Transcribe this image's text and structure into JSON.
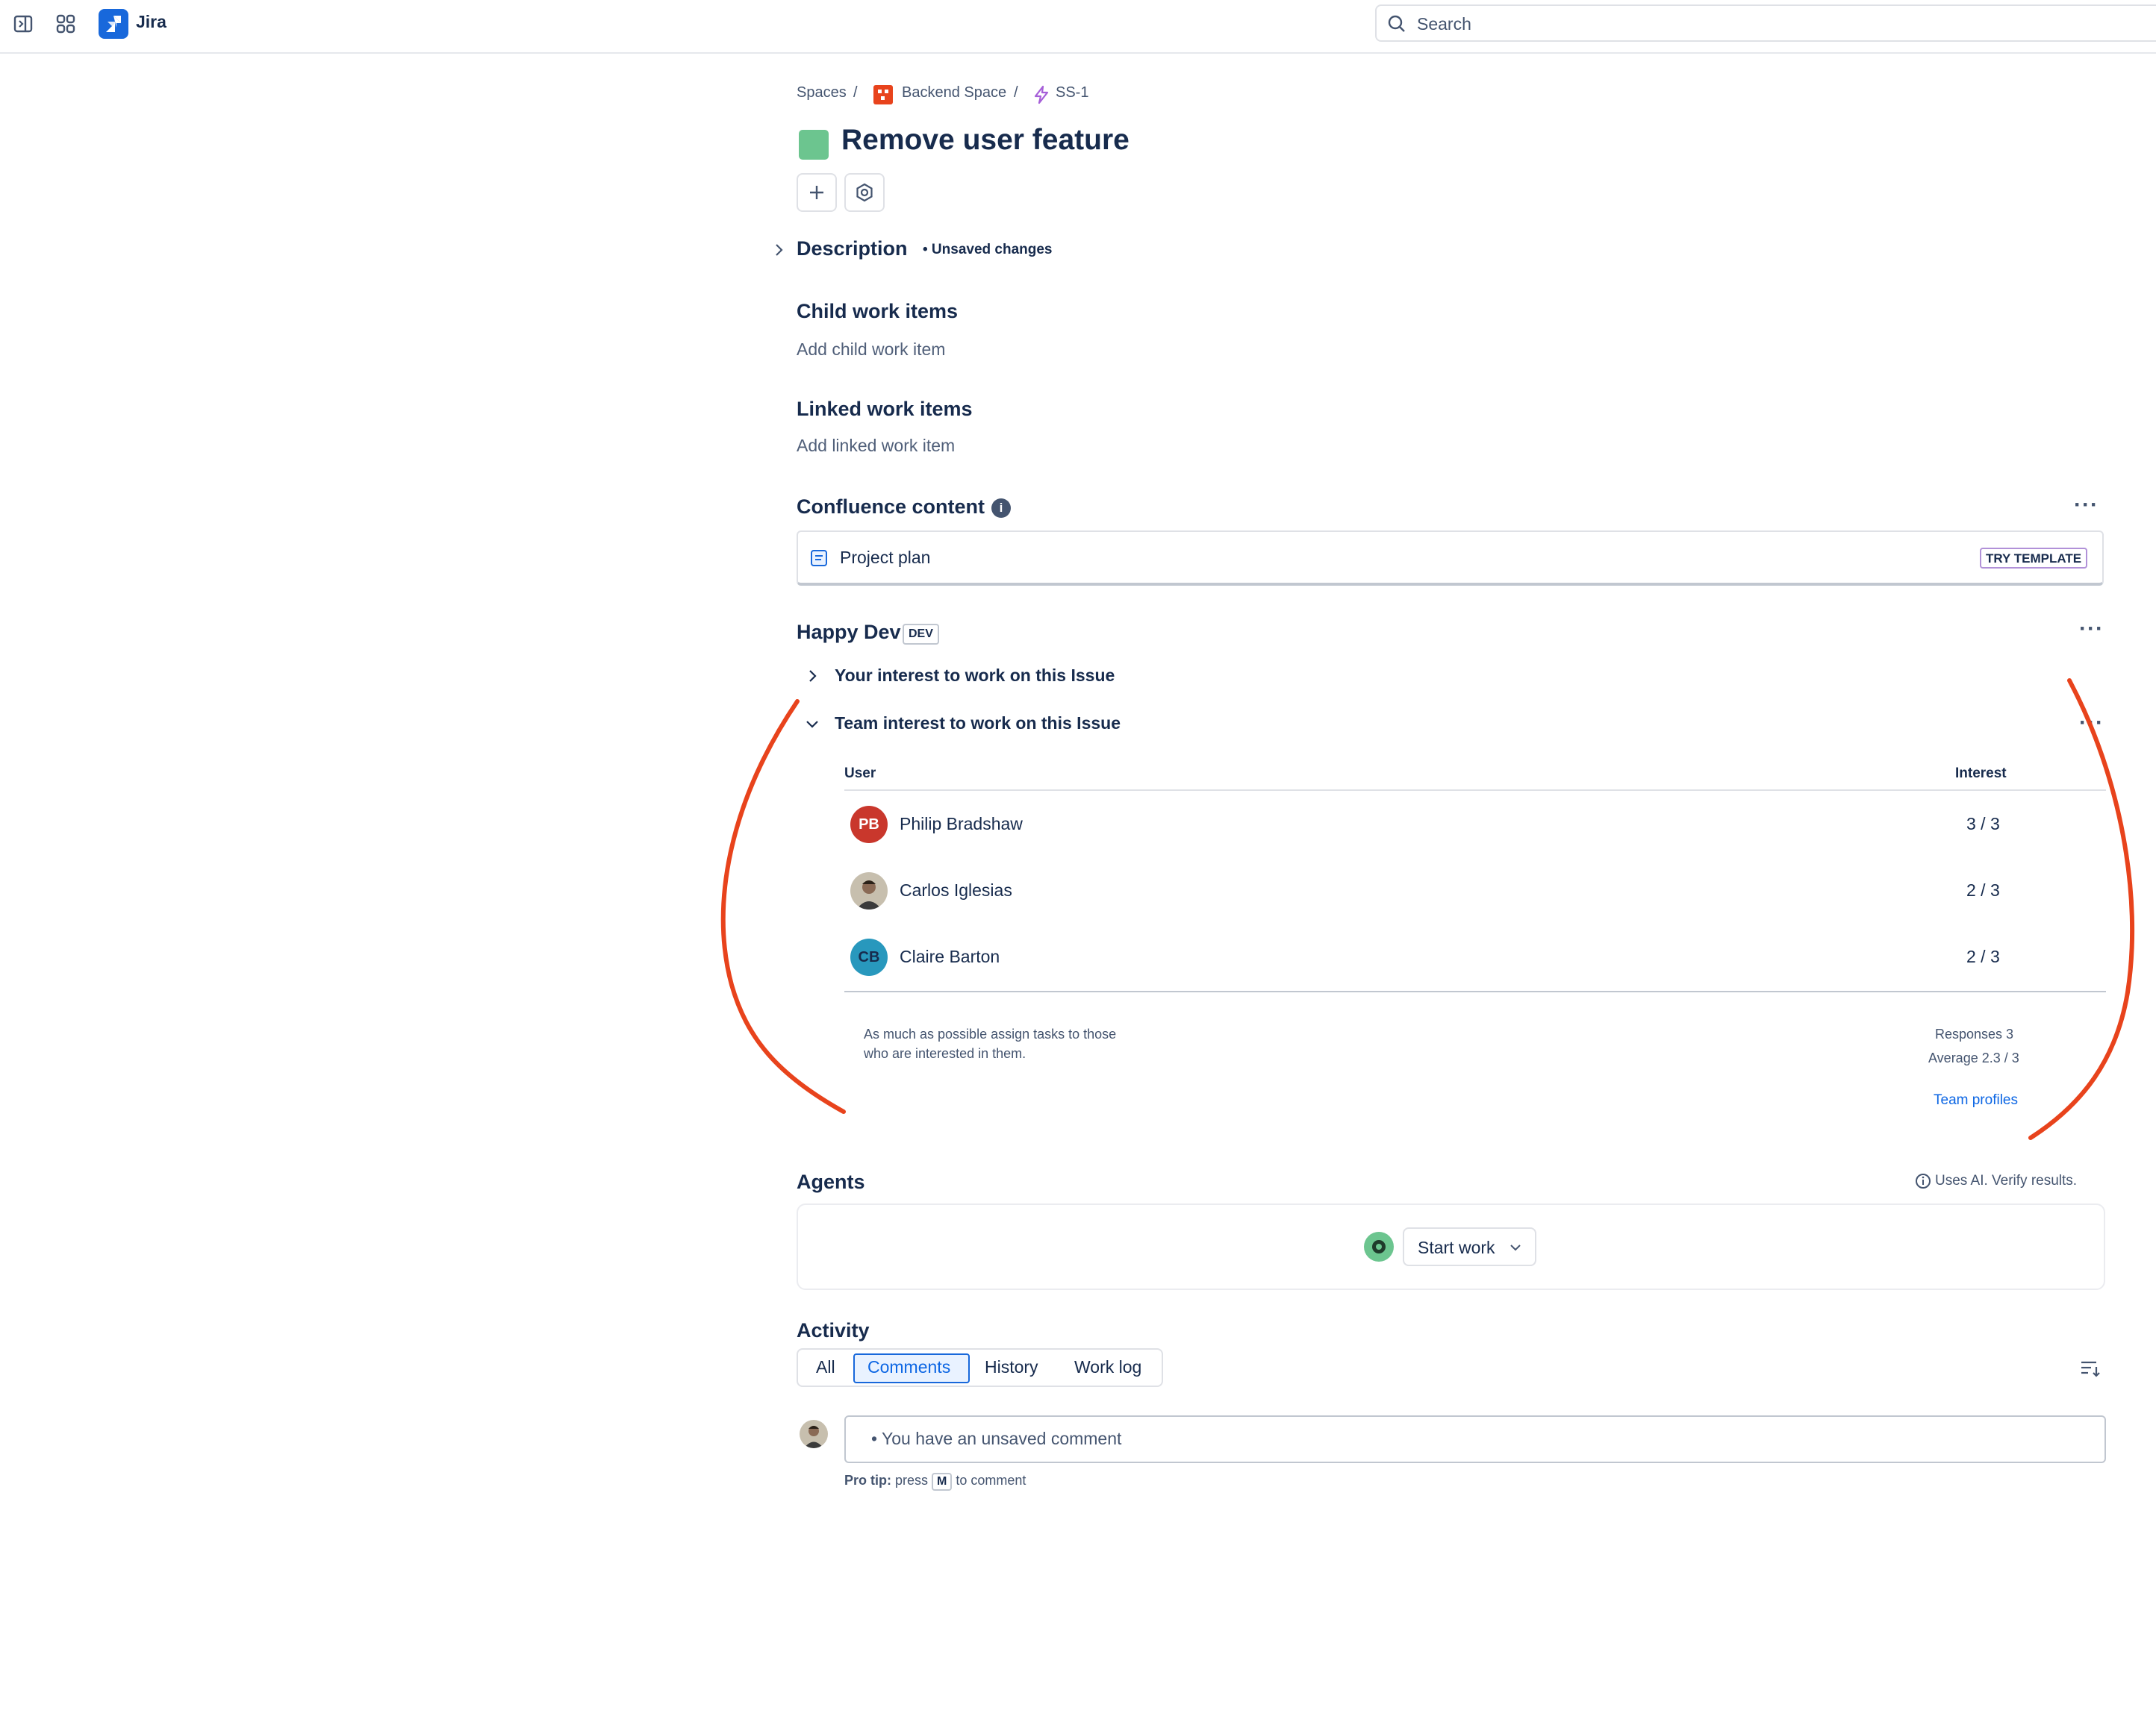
{
  "app": {
    "title": "Jira",
    "search_placeholder": "Search"
  },
  "breadcrumb": {
    "spaces": "Spaces",
    "space": "Backend Space",
    "issue_key": "SS-1"
  },
  "issue": {
    "title": "Remove user feature"
  },
  "description": {
    "heading": "Description",
    "status": "• Unsaved changes"
  },
  "child_items": {
    "heading": "Child work items",
    "add": "Add child work item"
  },
  "linked_items": {
    "heading": "Linked work items",
    "add": "Add linked work item"
  },
  "confluence": {
    "heading": "Confluence content",
    "item": "Project plan",
    "badge": "TRY TEMPLATE"
  },
  "happy_dev": {
    "heading": "Happy Dev",
    "badge": "DEV",
    "your_interest": "Your interest to work on this Issue",
    "team_interest": "Team interest to work on this Issue",
    "columns": {
      "user": "User",
      "interest": "Interest"
    },
    "rows": [
      {
        "initials": "PB",
        "name": "Philip Bradshaw",
        "interest": "3 / 3",
        "color": "#c9372c"
      },
      {
        "initials": "",
        "name": "Carlos Iglesias",
        "interest": "2 / 3",
        "color": "#8a7e6a"
      },
      {
        "initials": "CB",
        "name": "Claire Barton",
        "interest": "2 / 3",
        "color": "#2898bd"
      }
    ],
    "note_line1": "As much as possible assign tasks to those",
    "note_line2": "who are interested in them.",
    "responses": "Responses 3",
    "average": "Average 2.3 / 3",
    "team_profiles": "Team profiles"
  },
  "agents": {
    "heading": "Agents",
    "ai_note": "Uses AI. Verify results.",
    "start_work": "Start work"
  },
  "activity": {
    "heading": "Activity",
    "tabs": [
      "All",
      "Comments",
      "History",
      "Work log"
    ],
    "active_tab": "Comments",
    "comment_placeholder": "• You have an unsaved comment",
    "pro_tip_label": "Pro tip:",
    "pro_tip_press": "press",
    "pro_tip_key": "M",
    "pro_tip_suffix": "to comment"
  },
  "colors": {
    "accent": "#1868db",
    "annotation": "#e8431c",
    "issue_type": "#6cc58f"
  }
}
